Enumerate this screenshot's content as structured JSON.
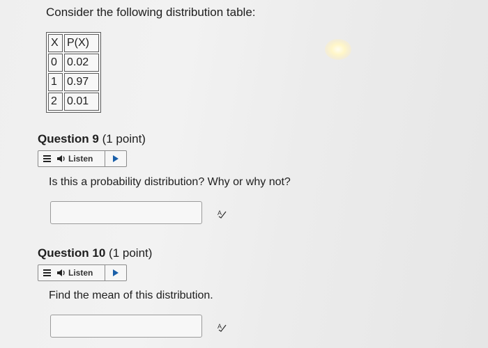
{
  "intro_text": "Consider the following distribution table:",
  "table": {
    "headers": [
      "X",
      "P(X)"
    ],
    "rows": [
      [
        "0",
        "0.02"
      ],
      [
        "1",
        "0.97"
      ],
      [
        "2",
        "0.01"
      ]
    ]
  },
  "questions": [
    {
      "number_label": "Question 9",
      "points_label": "(1 point)",
      "listen_label": "Listen",
      "prompt": "Is this a probability distribution? Why or why not?",
      "answer_value": "",
      "spellcheck_icon": "spellcheck-icon"
    },
    {
      "number_label": "Question 10",
      "points_label": "(1 point)",
      "listen_label": "Listen",
      "prompt": "Find the mean of this distribution.",
      "answer_value": "",
      "spellcheck_icon": "spellcheck-icon"
    }
  ],
  "colors": {
    "play_accent": "#1a5fa8"
  }
}
